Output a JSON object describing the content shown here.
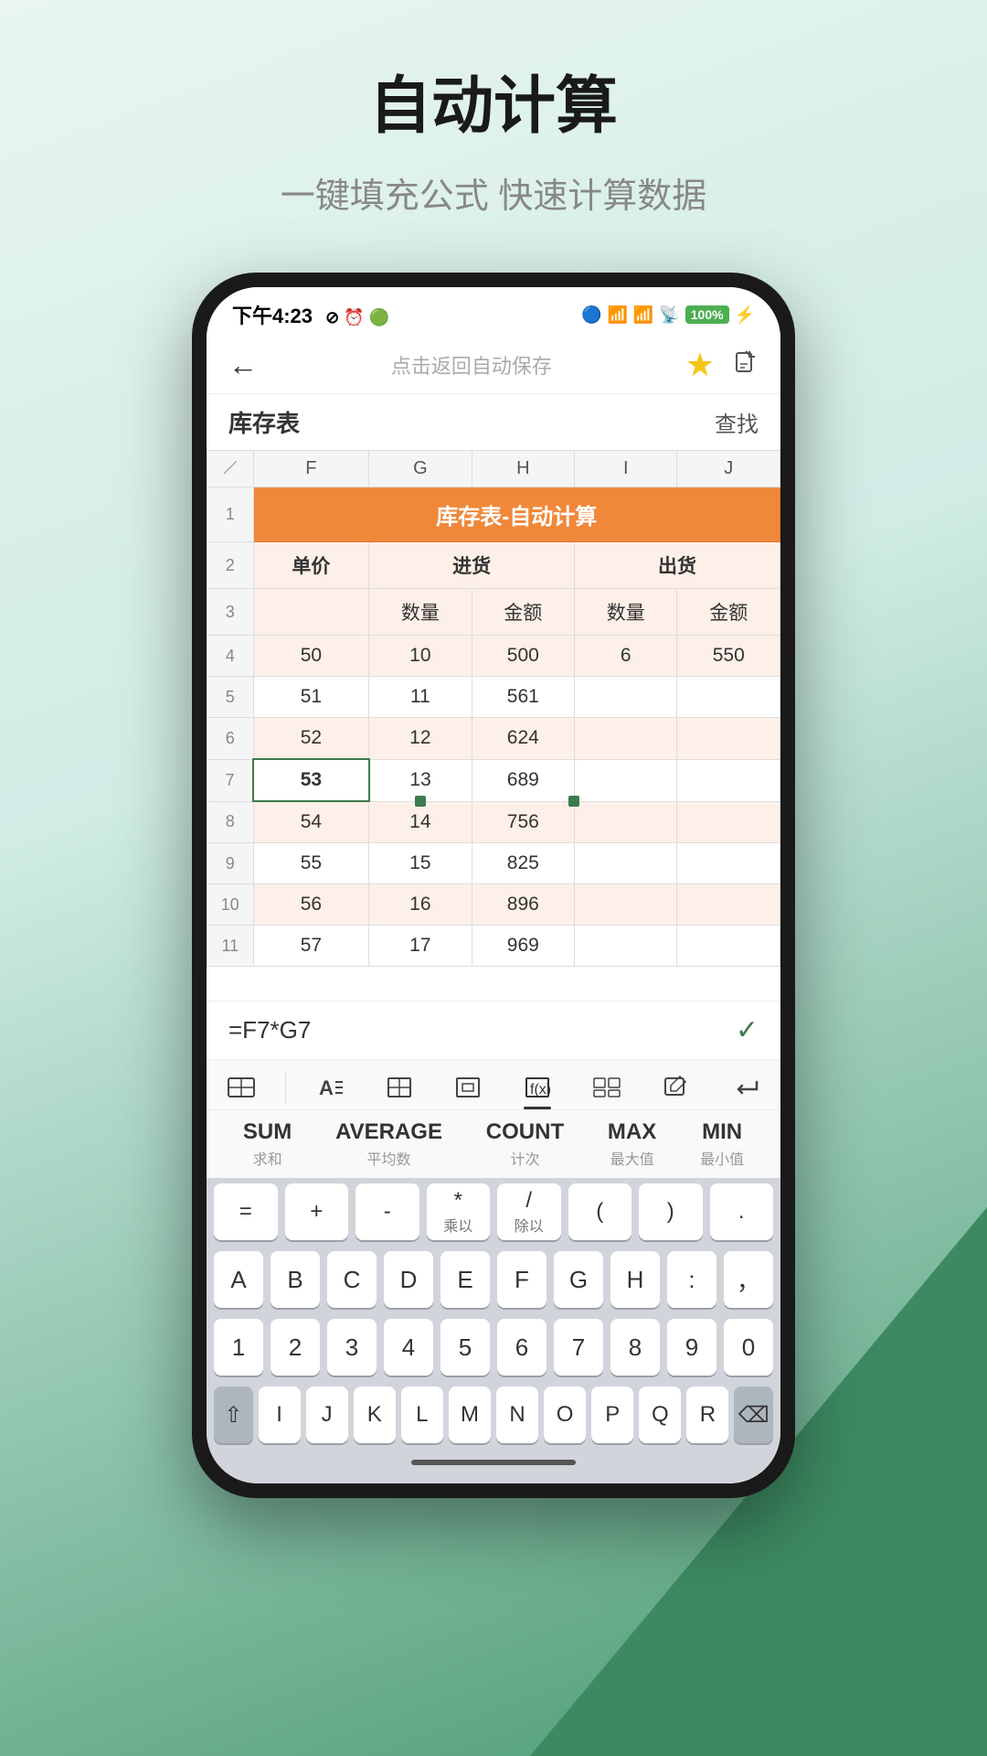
{
  "page": {
    "title": "自动计算",
    "subtitle": "一键填充公式 快速计算数据"
  },
  "status_bar": {
    "time": "下午4:23",
    "battery": "100"
  },
  "nav": {
    "center_text": "点击返回自动保存",
    "back_label": "←"
  },
  "sheet": {
    "name": "库存表",
    "find_label": "查找",
    "table_title": "库存表-自动计算"
  },
  "columns": {
    "row_num": "",
    "f": "F",
    "g": "G",
    "h": "H",
    "i": "I",
    "j": "J"
  },
  "rows": [
    {
      "num": "1",
      "cells": [
        "库存表-自动计算"
      ],
      "type": "title"
    },
    {
      "num": "2",
      "cells": [
        "单价",
        "进货",
        "",
        "出货",
        ""
      ],
      "type": "header"
    },
    {
      "num": "3",
      "cells": [
        "",
        "数量",
        "金额",
        "数量",
        "金额"
      ],
      "type": "subheader"
    },
    {
      "num": "4",
      "cells": [
        "50",
        "10",
        "500",
        "6",
        "550"
      ],
      "type": "orange"
    },
    {
      "num": "5",
      "cells": [
        "51",
        "11",
        "561",
        "",
        ""
      ],
      "type": "white"
    },
    {
      "num": "6",
      "cells": [
        "52",
        "12",
        "624",
        "",
        ""
      ],
      "type": "orange"
    },
    {
      "num": "7",
      "cells": [
        "53",
        "13",
        "689",
        "",
        ""
      ],
      "type": "white",
      "selected": 0
    },
    {
      "num": "8",
      "cells": [
        "54",
        "14",
        "756",
        "",
        ""
      ],
      "type": "orange"
    },
    {
      "num": "9",
      "cells": [
        "55",
        "15",
        "825",
        "",
        ""
      ],
      "type": "white"
    },
    {
      "num": "10",
      "cells": [
        "56",
        "16",
        "896",
        "",
        ""
      ],
      "type": "orange"
    },
    {
      "num": "11",
      "cells": [
        "57",
        "17",
        "969",
        "",
        ""
      ],
      "type": "white"
    }
  ],
  "formula": {
    "text": "=F7*G7",
    "check_icon": "✓"
  },
  "toolbar": {
    "items": [
      "⊟",
      "A≡",
      "⊞",
      "⊡",
      "⊘",
      "⊡⊡",
      "🖺",
      "↵"
    ]
  },
  "functions": [
    {
      "name": "SUM",
      "sub": "求和"
    },
    {
      "name": "AVERAGE",
      "sub": "平均数"
    },
    {
      "name": "COUNT",
      "sub": "计次"
    },
    {
      "name": "MAX",
      "sub": "最大值"
    },
    {
      "name": "MIN",
      "sub": "最小值"
    }
  ],
  "keyboard": {
    "symbols": [
      {
        "main": "=",
        "sub": ""
      },
      {
        "main": "+",
        "sub": ""
      },
      {
        "main": "-",
        "sub": ""
      },
      {
        "main": "*",
        "sub": "乘以"
      },
      {
        "main": "/",
        "sub": "除以"
      },
      {
        "main": "(",
        "sub": ""
      },
      {
        "main": ")",
        "sub": ""
      },
      {
        "main": ".",
        "sub": ""
      }
    ],
    "letters1": [
      "A",
      "B",
      "C",
      "D",
      "E",
      "F",
      "G",
      "H",
      ":",
      "，"
    ],
    "letters2": [
      "1",
      "2",
      "3",
      "4",
      "5",
      "6",
      "7",
      "8",
      "9",
      "0"
    ],
    "letters3": [
      "I",
      "J",
      "K",
      "L",
      "M",
      "N",
      "O",
      "P",
      "Q",
      "R"
    ]
  }
}
